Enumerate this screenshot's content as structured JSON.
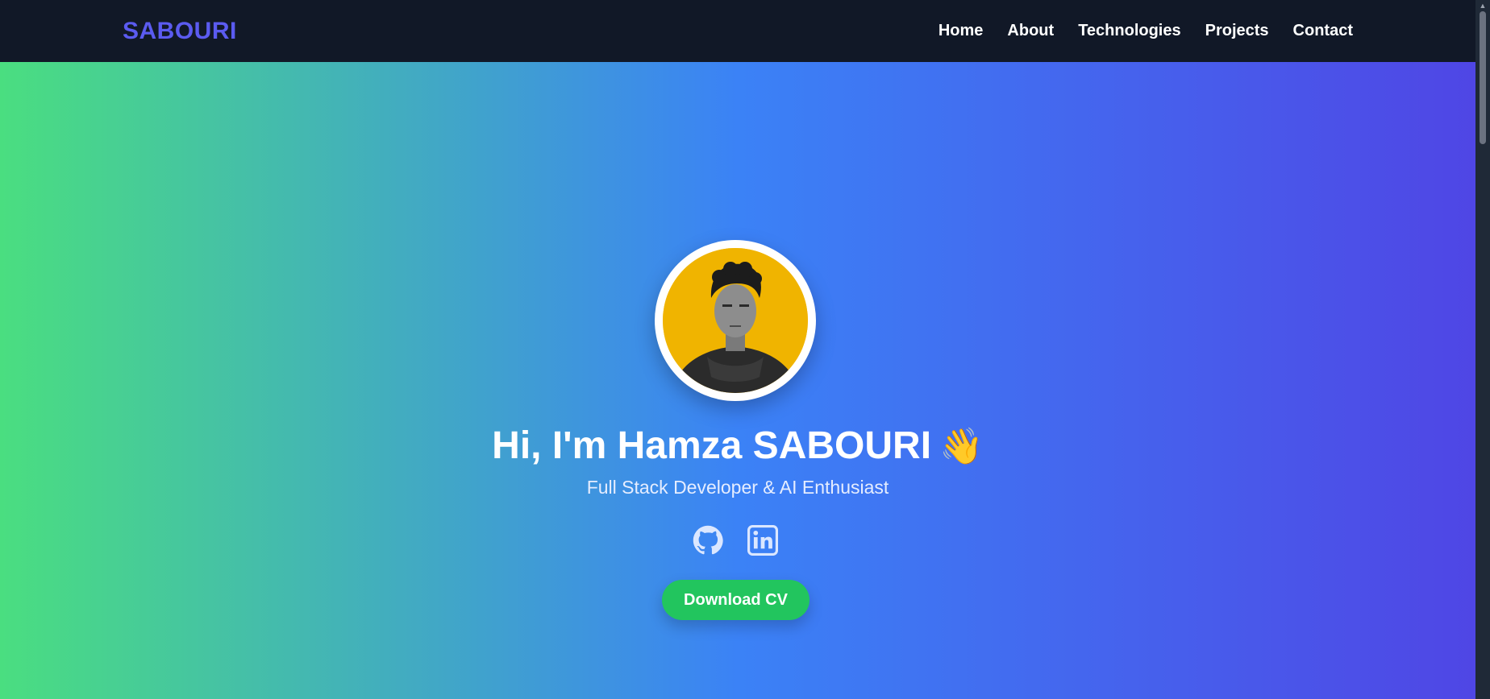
{
  "nav": {
    "brand": "SABOURI",
    "links": [
      "Home",
      "About",
      "Technologies",
      "Projects",
      "Contact"
    ]
  },
  "hero": {
    "headline": "Hi, I'm Hamza SABOURI",
    "wave_emoji": "👋",
    "subtitle": "Full Stack Developer & AI Enthusiast",
    "socials": [
      "github-icon",
      "linkedin-icon"
    ],
    "cta": "Download CV"
  },
  "colors": {
    "nav_bg": "#111827",
    "brand": "#5b5bf0",
    "gradient_start": "#4ade80",
    "gradient_mid": "#3b82f6",
    "gradient_end": "#4f46e5",
    "button": "#22c55e",
    "avatar_bg": "#f0b400"
  }
}
